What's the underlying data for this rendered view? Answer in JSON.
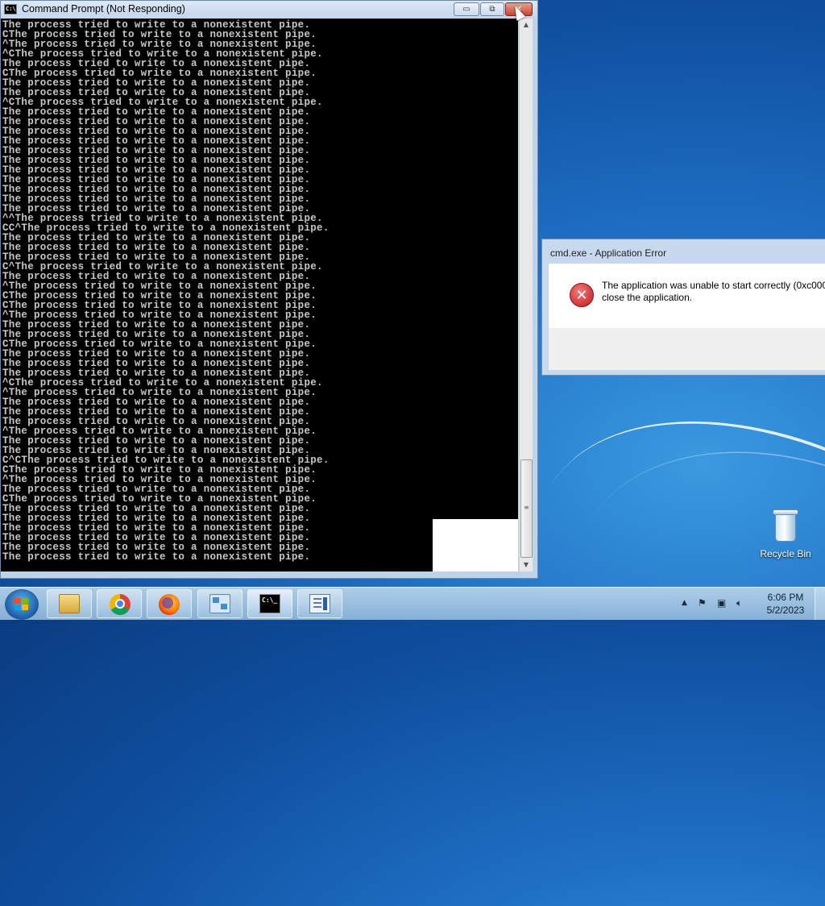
{
  "cmd_window": {
    "title": "Command Prompt (Not Responding)",
    "icon_label": "C:\\",
    "buttons": {
      "minimize": "▭",
      "maximize": "⧉",
      "close": "✕"
    },
    "lines": [
      "The process tried to write to a nonexistent pipe.",
      "CThe process tried to write to a nonexistent pipe.",
      "^The process tried to write to a nonexistent pipe.",
      "^CThe process tried to write to a nonexistent pipe.",
      "The process tried to write to a nonexistent pipe.",
      "CThe process tried to write to a nonexistent pipe.",
      "The process tried to write to a nonexistent pipe.",
      "The process tried to write to a nonexistent pipe.",
      "^CThe process tried to write to a nonexistent pipe.",
      "The process tried to write to a nonexistent pipe.",
      "The process tried to write to a nonexistent pipe.",
      "The process tried to write to a nonexistent pipe.",
      "The process tried to write to a nonexistent pipe.",
      "The process tried to write to a nonexistent pipe.",
      "The process tried to write to a nonexistent pipe.",
      "The process tried to write to a nonexistent pipe.",
      "The process tried to write to a nonexistent pipe.",
      "The process tried to write to a nonexistent pipe.",
      "The process tried to write to a nonexistent pipe.",
      "The process tried to write to a nonexistent pipe.",
      "^^The process tried to write to a nonexistent pipe.",
      "CC^The process tried to write to a nonexistent pipe.",
      "The process tried to write to a nonexistent pipe.",
      "The process tried to write to a nonexistent pipe.",
      "The process tried to write to a nonexistent pipe.",
      "C^The process tried to write to a nonexistent pipe.",
      "The process tried to write to a nonexistent pipe.",
      "^The process tried to write to a nonexistent pipe.",
      "CThe process tried to write to a nonexistent pipe.",
      "CThe process tried to write to a nonexistent pipe.",
      "^The process tried to write to a nonexistent pipe.",
      "The process tried to write to a nonexistent pipe.",
      "The process tried to write to a nonexistent pipe.",
      "CThe process tried to write to a nonexistent pipe.",
      "The process tried to write to a nonexistent pipe.",
      "The process tried to write to a nonexistent pipe.",
      "The process tried to write to a nonexistent pipe.",
      "^CThe process tried to write to a nonexistent pipe.",
      "^The process tried to write to a nonexistent pipe.",
      "The process tried to write to a nonexistent pipe.",
      "The process tried to write to a nonexistent pipe.",
      "The process tried to write to a nonexistent pipe.",
      "^The process tried to write to a nonexistent pipe.",
      "The process tried to write to a nonexistent pipe.",
      "The process tried to write to a nonexistent pipe.",
      "C^CThe process tried to write to a nonexistent pipe.",
      "CThe process tried to write to a nonexistent pipe.",
      "^The process tried to write to a nonexistent pipe.",
      "The process tried to write to a nonexistent pipe.",
      "CThe process tried to write to a nonexistent pipe.",
      "The process tried to write to a nonexistent pipe.",
      "The process tried to write to a nonexistent pipe.",
      "The process tried to write to a nonexistent pipe.",
      "The process tried to write to a nonexistent pipe.",
      "The process tried to write to a nonexistent pipe.",
      "The process tried to write to a nonexistent pipe."
    ]
  },
  "error_dialog": {
    "title": "cmd.exe - Application Error",
    "icon": "error-x-icon",
    "icon_glyph": "✕",
    "message_line1": "The application was unable to start correctly (0xc0000",
    "message_line2": "close the application."
  },
  "desktop": {
    "recycle_bin_label": "Recycle Bin"
  },
  "taskbar": {
    "pinned": [
      "folder-icon",
      "chrome-icon",
      "firefox-icon",
      "network-icon",
      "cmd-icon",
      "app-icon"
    ],
    "cmd_icon_label": "C:\\_",
    "tray_arrow": "▲",
    "clock_time": "6:06 PM",
    "clock_date": "5/2/2023"
  }
}
